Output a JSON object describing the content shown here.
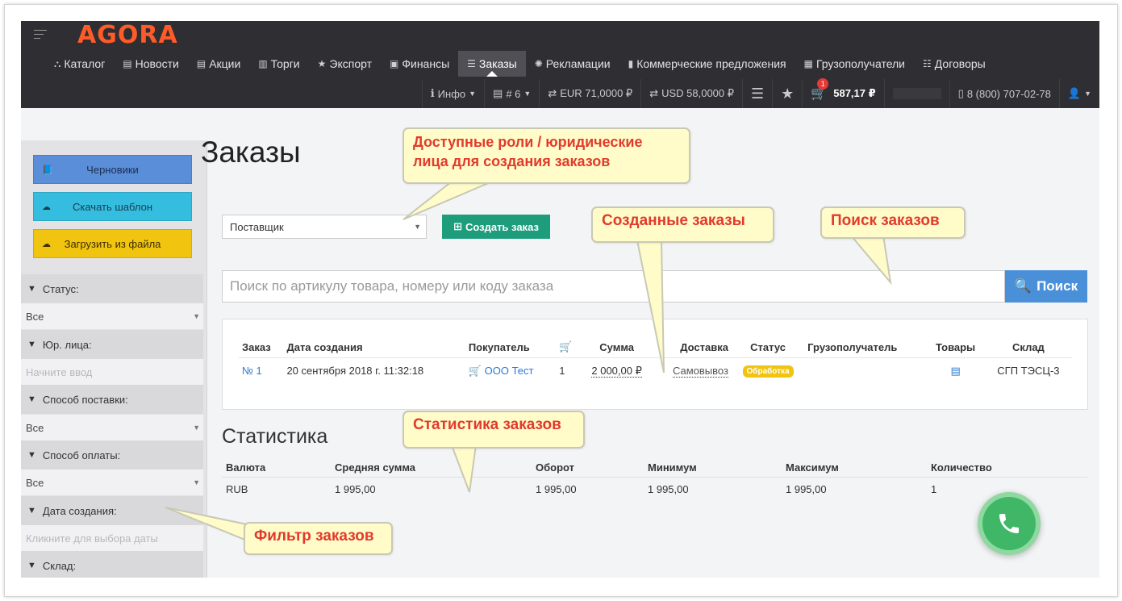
{
  "header": {
    "logo": "AGORA",
    "nav": [
      {
        "icon": "sitemap-icon",
        "glyph": "⛬",
        "label": "Каталог"
      },
      {
        "icon": "file-icon",
        "glyph": "▤",
        "label": "Новости"
      },
      {
        "icon": "file-icon",
        "glyph": "▤",
        "label": "Акции"
      },
      {
        "icon": "columns-icon",
        "glyph": "▥",
        "label": "Торги"
      },
      {
        "icon": "star-icon",
        "glyph": "★",
        "label": "Экспорт"
      },
      {
        "icon": "money-icon",
        "glyph": "▣",
        "label": "Финансы"
      },
      {
        "icon": "list-icon",
        "glyph": "☰",
        "label": "Заказы",
        "active": true
      },
      {
        "icon": "gear-icon",
        "glyph": "✺",
        "label": "Рекламации"
      },
      {
        "icon": "bookmark-icon",
        "glyph": "▮",
        "label": "Коммерческие предложения"
      },
      {
        "icon": "building-icon",
        "glyph": "▦",
        "label": "Грузополучатели"
      },
      {
        "icon": "list-alt-icon",
        "glyph": "☷",
        "label": "Договоры"
      }
    ],
    "bar2": {
      "info": "Инфо",
      "doc": "# 6",
      "eur": "EUR 71,0000 ₽",
      "usd": "USD 58,0000 ₽",
      "cart_count": "1",
      "cart_total": "587,17 ₽",
      "phone": "8 (800) 707-02-78"
    }
  },
  "sidebar": {
    "buttons": [
      {
        "label": "Черновики",
        "icon": "book-icon"
      },
      {
        "label": "Скачать шаблон",
        "icon": "cloud-download-icon"
      },
      {
        "label": "Загрузить из файла",
        "icon": "cloud-upload-icon"
      }
    ],
    "filters": [
      {
        "label": "Статус:",
        "value": "Все",
        "placeholder": false
      },
      {
        "label": "Юр. лица:",
        "value": "Начните ввод",
        "placeholder": true
      },
      {
        "label": "Способ поставки:",
        "value": "Все",
        "placeholder": false
      },
      {
        "label": "Способ оплаты:",
        "value": "Все",
        "placeholder": false
      },
      {
        "label": "Дата создания:",
        "value": "Кликните для выбора даты",
        "placeholder": true
      },
      {
        "label": "Склад:"
      }
    ]
  },
  "main": {
    "title": "Заказы",
    "role_select": "Поставщик",
    "create_button": "Создать заказ",
    "search_placeholder": "Поиск по артикулу товара, номеру или коду заказа",
    "search_button": "Поиск",
    "orders": {
      "columns": [
        "Заказ",
        "Дата создания",
        "Покупатель",
        "",
        "Сумма",
        "Доставка",
        "Статус",
        "Грузополучатель",
        "Товары",
        "Склад"
      ],
      "rows": [
        {
          "number": "№ 1",
          "date": "20 сентября 2018 г. 11:32:18",
          "buyer": "ООО Тест",
          "qty": "1",
          "sum": "2 000,00 ₽",
          "delivery": "Самовывоз",
          "status": "Обработка",
          "consignee": "",
          "warehouse": "СГП ТЭСЦ-3"
        }
      ]
    },
    "stats": {
      "title": "Статистика",
      "columns": [
        "Валюта",
        "Средняя сумма",
        "Оборот",
        "Минимум",
        "Максимум",
        "Количество"
      ],
      "rows": [
        [
          "RUB",
          "1 995,00",
          "1 995,00",
          "1 995,00",
          "1 995,00",
          "1"
        ]
      ]
    }
  },
  "annotations": {
    "roles": "Доступные роли / юридические лица для создания заказов",
    "created": "Созданные заказы",
    "search": "Поиск заказов",
    "stats": "Статистика заказов",
    "filter": "Фильтр заказов"
  },
  "colors": {
    "header_bg": "#2f2f33",
    "logo": "#ff5b29",
    "create_button": "#1e9d7c",
    "search_button": "#4a90d9",
    "status_badge": "#f1c40f",
    "callout_bg": "#fffcc9",
    "callout_text": "#e23a2c",
    "phone_fab": "#3fb767"
  }
}
